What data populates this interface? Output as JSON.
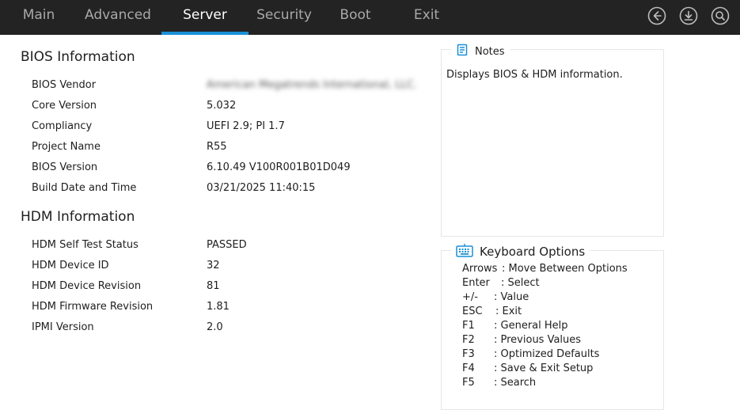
{
  "nav": {
    "tabs": [
      {
        "label": "Main"
      },
      {
        "label": "Advanced"
      },
      {
        "label": "Server"
      },
      {
        "label": "Security"
      },
      {
        "label": "Boot"
      },
      {
        "label": "Exit"
      }
    ],
    "active_tab": "Server",
    "icons": [
      "back-arrow-icon",
      "download-icon",
      "search-icon"
    ],
    "colors": {
      "bar": "#232323",
      "accent": "#1a8fd6",
      "inactive_text": "#a9a9a9"
    }
  },
  "bios": {
    "title": "BIOS Information",
    "rows": [
      {
        "label": "BIOS Vendor",
        "value": "American Megatrends International, LLC."
      },
      {
        "label": "Core Version",
        "value": "5.032"
      },
      {
        "label": "Compliancy",
        "value": "UEFI 2.9; PI 1.7"
      },
      {
        "label": "Project Name",
        "value": "R55"
      },
      {
        "label": "BIOS Version",
        "value": "6.10.49 V100R001B01D049"
      },
      {
        "label": "Build Date and Time",
        "value": "03/21/2025 11:40:15"
      }
    ]
  },
  "hdm": {
    "title": "HDM Information",
    "rows": [
      {
        "label": "HDM Self Test Status",
        "value": "PASSED"
      },
      {
        "label": "HDM Device ID",
        "value": "32"
      },
      {
        "label": "HDM Device Revision",
        "value": "81"
      },
      {
        "label": "HDM Firmware Revision",
        "value": "1.81"
      },
      {
        "label": "IPMI Version",
        "value": "2.0"
      }
    ]
  },
  "notes": {
    "title": "Notes",
    "icon": "notes-icon",
    "text": "Displays BIOS & HDM information."
  },
  "keyboard": {
    "title": "Keyboard Options",
    "icon": "keyboard-icon",
    "items": [
      {
        "key": "Arrows",
        "desc": ": Move Between Options"
      },
      {
        "key": "Enter",
        "desc": ": Select"
      },
      {
        "key": "+/-",
        "desc": ": Value"
      },
      {
        "key": "ESC",
        "desc": ": Exit"
      },
      {
        "key": "F1",
        "desc": ": General Help"
      },
      {
        "key": "F2",
        "desc": ": Previous Values"
      },
      {
        "key": "F3",
        "desc": ": Optimized Defaults"
      },
      {
        "key": "F4",
        "desc": ": Save & Exit Setup"
      },
      {
        "key": "F5",
        "desc": ": Search"
      }
    ]
  }
}
